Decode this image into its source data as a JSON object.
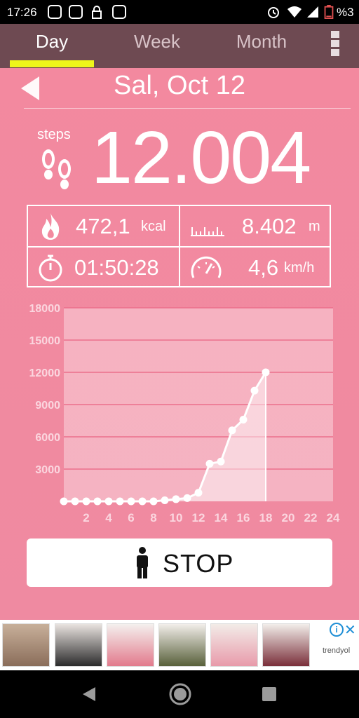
{
  "status_bar": {
    "time": "17:26",
    "battery": "%3",
    "icons": [
      "instagram-icon",
      "instagram-icon",
      "lock-icon",
      "footsteps-app-icon",
      "alarm-icon",
      "wifi-icon",
      "signal-icon",
      "battery-icon"
    ]
  },
  "tabs": [
    {
      "label": "Day",
      "active": true
    },
    {
      "label": "Week",
      "active": false
    },
    {
      "label": "Month",
      "active": false
    }
  ],
  "header": {
    "date": "Sal, Oct 12"
  },
  "steps": {
    "label": "steps",
    "value": "12.004"
  },
  "stats": {
    "calories": {
      "value": "472,1",
      "unit": "kcal"
    },
    "distance": {
      "value": "8.402",
      "unit": "m"
    },
    "duration": {
      "value": "01:50:28"
    },
    "speed": {
      "value": "4,6",
      "unit": "km/h"
    }
  },
  "chart_data": {
    "type": "area",
    "x_ticks": [
      "2",
      "4",
      "6",
      "8",
      "10",
      "12",
      "14",
      "16",
      "18",
      "20",
      "22",
      "24"
    ],
    "y_ticks": [
      "3000",
      "6000",
      "9000",
      "12000",
      "15000",
      "18000"
    ],
    "ylim": [
      0,
      18000
    ],
    "xlim": [
      0,
      24
    ],
    "grid": true,
    "x": [
      0,
      1,
      2,
      3,
      4,
      5,
      6,
      7,
      8,
      9,
      10,
      11,
      12,
      13,
      14,
      15,
      16,
      17,
      18
    ],
    "values": [
      0,
      0,
      0,
      0,
      0,
      0,
      0,
      0,
      0,
      100,
      200,
      300,
      800,
      3500,
      3700,
      6600,
      7600,
      10300,
      12004
    ]
  },
  "stop_button": {
    "label": "STOP"
  },
  "ad": {
    "brand": "trendyol",
    "info": "i",
    "close": "✕"
  },
  "colors": {
    "accent": "#eef51a",
    "tab_bar": "#6e4a52",
    "background": "#f3899f"
  }
}
